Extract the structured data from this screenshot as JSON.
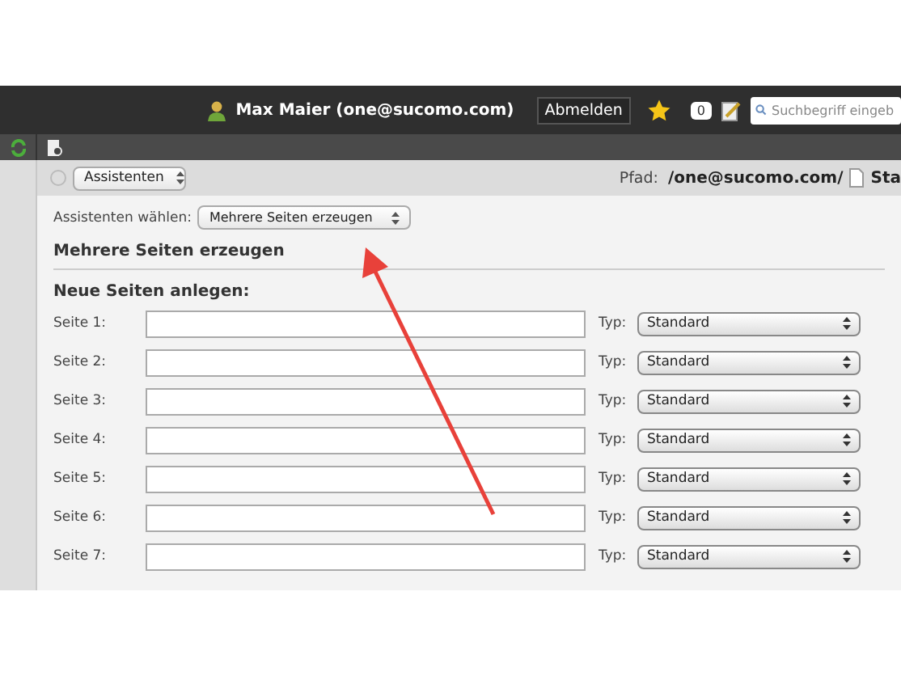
{
  "header": {
    "user": "Max Maier (one@sucomo.com)",
    "logout": "Abmelden",
    "badge": "0",
    "search": {
      "placeholder": "Suchbegriff eingeb"
    }
  },
  "toolbar": {
    "assistant_select": "Assistenten",
    "path_label": "Pfad:",
    "path": "/one@sucomo.com/",
    "path_tail": "Sta"
  },
  "wizard": {
    "label": "Assistenten wählen:",
    "value": "Mehrere Seiten erzeugen"
  },
  "title": "Mehrere Seiten erzeugen",
  "section": "Neue Seiten anlegen:",
  "rows": [
    {
      "label": "Seite 1:",
      "type_label": "Typ:",
      "type": "Standard"
    },
    {
      "label": "Seite 2:",
      "type_label": "Typ:",
      "type": "Standard"
    },
    {
      "label": "Seite 3:",
      "type_label": "Typ:",
      "type": "Standard"
    },
    {
      "label": "Seite 4:",
      "type_label": "Typ:",
      "type": "Standard"
    },
    {
      "label": "Seite 5:",
      "type_label": "Typ:",
      "type": "Standard"
    },
    {
      "label": "Seite 6:",
      "type_label": "Typ:",
      "type": "Standard"
    },
    {
      "label": "Seite 7:",
      "type_label": "Typ:",
      "type": "Standard"
    }
  ]
}
